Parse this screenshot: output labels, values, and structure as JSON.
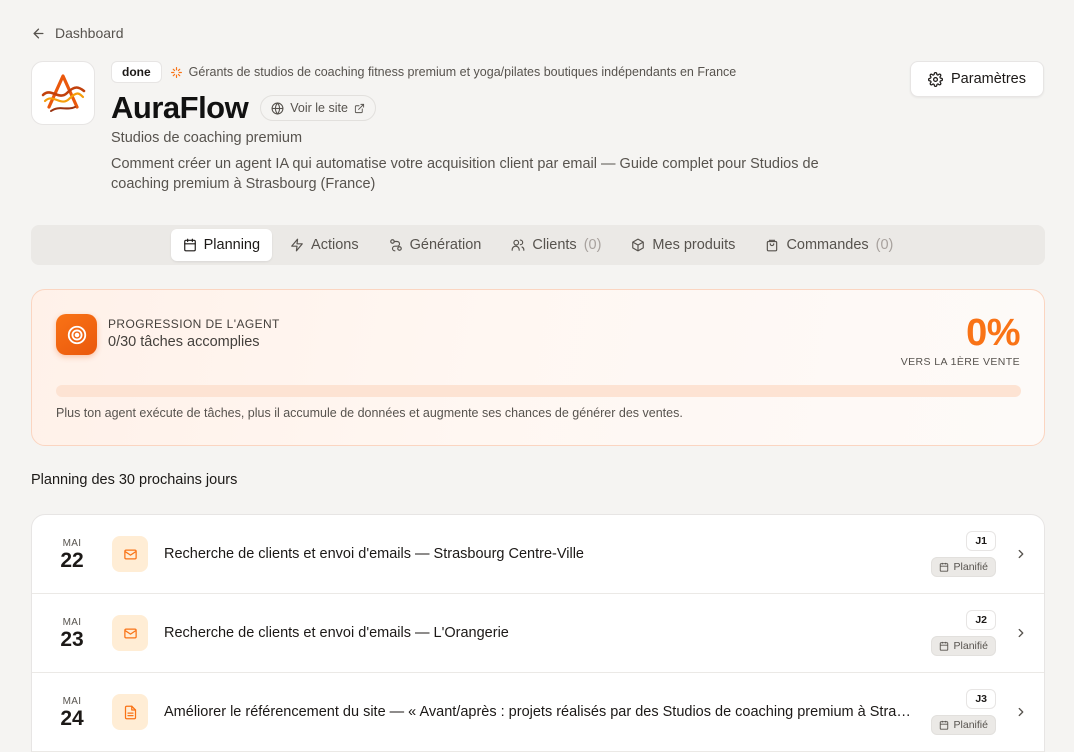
{
  "nav": {
    "back_label": "Dashboard"
  },
  "header": {
    "status": "done",
    "audience": "Gérants de studios de coaching fitness premium et yoga/pilates boutiques indépendants en France",
    "brand": "AuraFlow",
    "site_link": "Voir le site",
    "subtitle": "Studios de coaching premium",
    "description": "Comment créer un agent IA qui automatise votre acquisition client par email — Guide complet pour Studios de coaching premium à Strasbourg (France)",
    "settings_label": "Paramètres"
  },
  "tabs": [
    {
      "label": "Planning",
      "count": "",
      "icon": "calendar-icon",
      "active": true
    },
    {
      "label": "Actions",
      "count": "",
      "icon": "zap-icon",
      "active": false
    },
    {
      "label": "Génération",
      "count": "",
      "icon": "workflow-icon",
      "active": false
    },
    {
      "label": "Clients",
      "count": "(0)",
      "icon": "users-icon",
      "active": false
    },
    {
      "label": "Mes produits",
      "count": "",
      "icon": "package-icon",
      "active": false
    },
    {
      "label": "Commandes",
      "count": "(0)",
      "icon": "shopping-bag-icon",
      "active": false
    }
  ],
  "progress": {
    "label": "PROGRESSION DE L'AGENT",
    "count": "0/30 tâches accomplies",
    "percent_text": "0%",
    "percent_value": 0,
    "sub": "VERS LA 1ÈRE VENTE",
    "note": "Plus ton agent exécute de tâches, plus il accumule de données et augmente ses chances de générer des ventes."
  },
  "planning": {
    "title": "Planning des 30 prochains jours",
    "rows": [
      {
        "month": "MAI",
        "day": "22",
        "icon": "mail-icon",
        "title": "Recherche de clients et envoi d'emails — Strasbourg Centre-Ville",
        "day_badge": "J1",
        "status": "Planifié"
      },
      {
        "month": "MAI",
        "day": "23",
        "icon": "mail-icon",
        "title": "Recherche de clients et envoi d'emails — L'Orangerie",
        "day_badge": "J2",
        "status": "Planifié"
      },
      {
        "month": "MAI",
        "day": "24",
        "icon": "file-text-icon",
        "title": "Améliorer le référencement du site — « Avant/après : projets réalisés par des Studios de coaching premium à Strasbourg »",
        "day_badge": "J3",
        "status": "Planifié"
      }
    ]
  },
  "colors": {
    "accent": "#f97316",
    "accent_light": "#ffedd5",
    "background": "#f5f4f2"
  }
}
